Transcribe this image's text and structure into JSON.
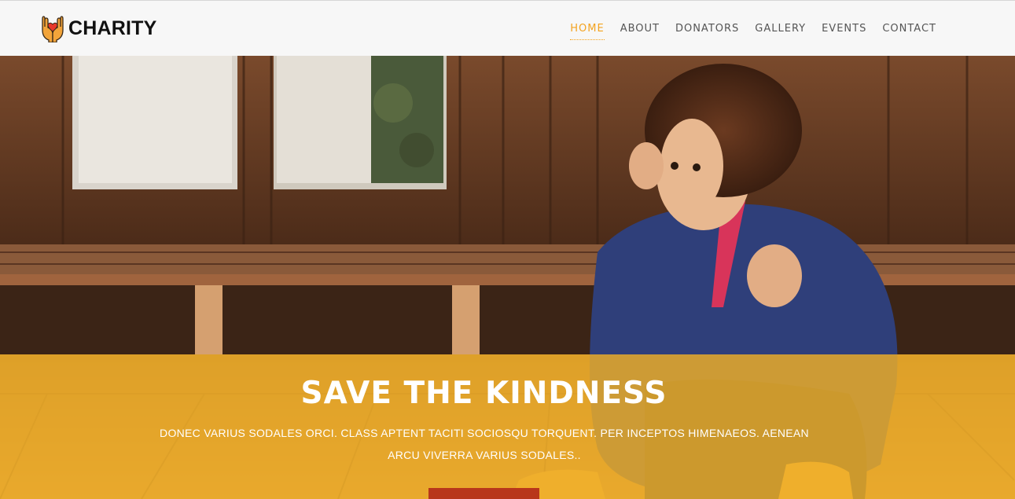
{
  "brand": {
    "name": "CHARITY",
    "logo_icon": "heart-in-hands-icon",
    "colors": {
      "heart": "#e8382b",
      "hands": "#f2a43a"
    }
  },
  "nav": {
    "items": [
      {
        "label": "HOME",
        "active": true
      },
      {
        "label": "ABOUT",
        "active": false
      },
      {
        "label": "DONATORS",
        "active": false
      },
      {
        "label": "GALLERY",
        "active": false
      },
      {
        "label": "EVENTS",
        "active": false
      },
      {
        "label": "CONTACT",
        "active": false
      }
    ],
    "active_color": "#f3a31f"
  },
  "hero": {
    "title": "SAVE THE KINDNESS",
    "text": "DONEC VARIUS SODALES ORCI. CLASS APTENT TACITI SOCIOSQU TORQUENT. PER INCEPTOS HIMENAEOS. AENEAN ARCU VIVERRA VARIUS SODALES..",
    "button_label": "",
    "overlay_color": "#f0b026",
    "button_color": "#b8361b"
  }
}
